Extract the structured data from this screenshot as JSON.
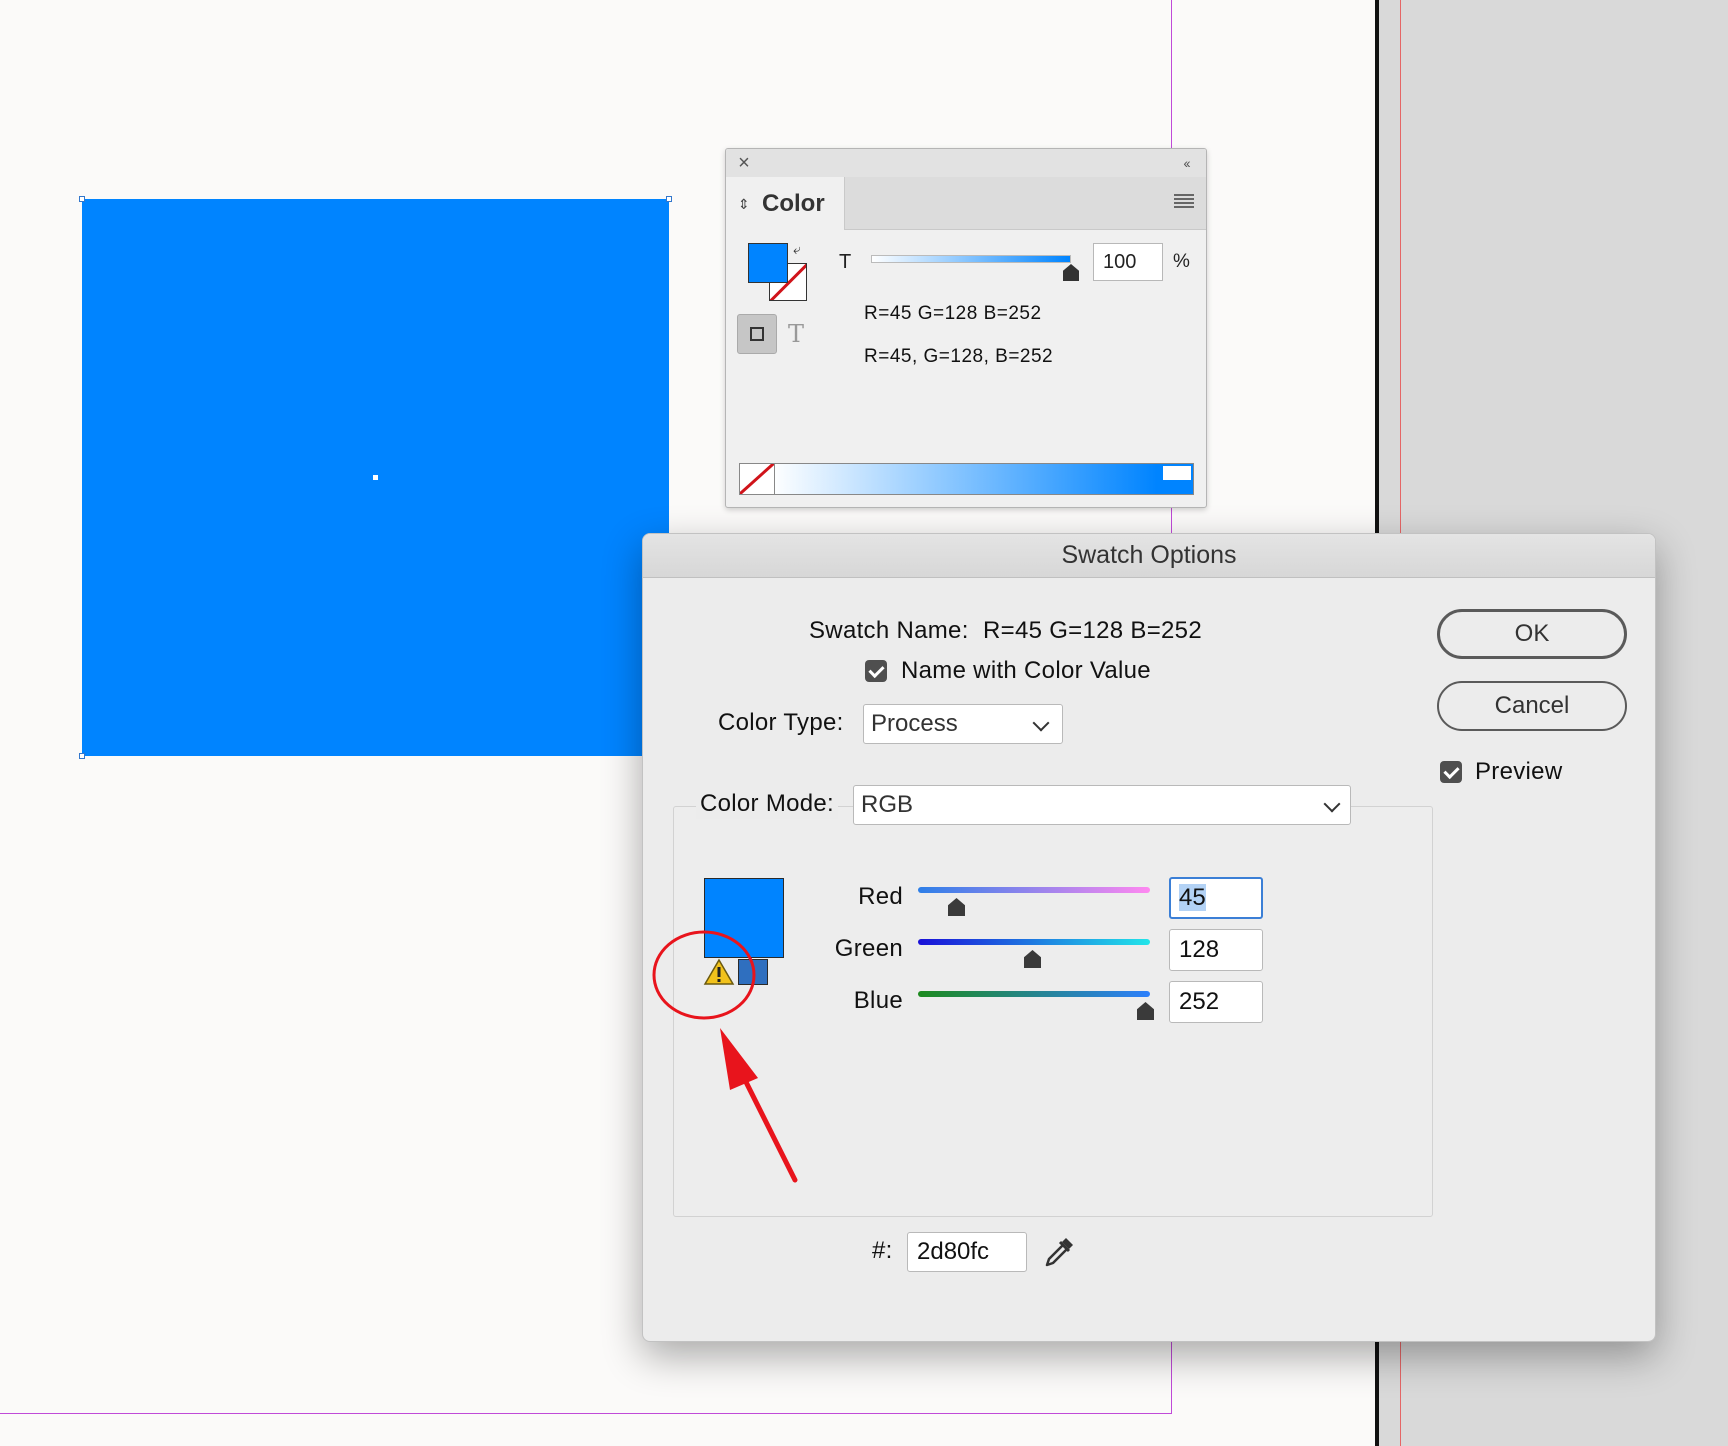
{
  "color_panel": {
    "tab_label": "Color",
    "tint_label": "T",
    "tint_value": "100",
    "tint_unit": "%",
    "tint_level_percent": 100,
    "color_name_line1": "R=45 G=128 B=252",
    "color_name_line2": "R=45, G=128, B=252",
    "icons": [
      "close-icon",
      "collapse-icon",
      "panel-menu-icon",
      "swap-icon",
      "none-swatch-icon"
    ]
  },
  "swatch_dialog": {
    "title": "Swatch Options",
    "swatch_name_label": "Swatch Name:",
    "swatch_name_value": "R=45 G=128 B=252",
    "name_with_color_value_label": "Name with Color Value",
    "name_with_color_value_checked": true,
    "color_type_label": "Color Type:",
    "color_type_value": "Process",
    "color_mode_label": "Color Mode:",
    "color_mode_value": "RGB",
    "sliders": [
      {
        "label": "Red",
        "value": "45",
        "max": 255
      },
      {
        "label": "Green",
        "value": "128",
        "max": 255
      },
      {
        "label": "Blue",
        "value": "252",
        "max": 255
      }
    ],
    "hex_label": "#:",
    "hex_value": "2d80fc",
    "ok_label": "OK",
    "cancel_label": "Cancel",
    "preview_label": "Preview",
    "preview_checked": true
  },
  "colors": {
    "swatch_fill": "#0084ff",
    "out_of_gamut_swatch": "#2f6fbf",
    "annotation_red": "#e8141c",
    "warning_yellow": "#f2c21b"
  }
}
